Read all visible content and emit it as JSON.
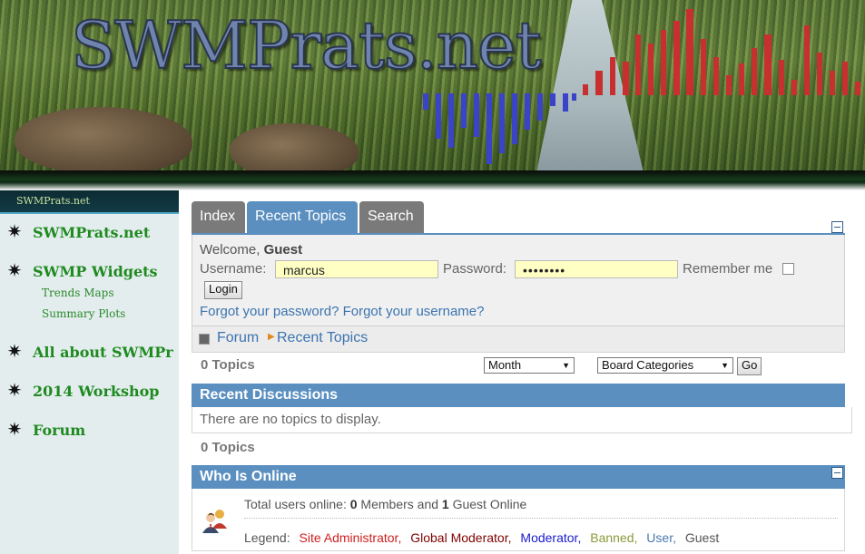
{
  "banner": {
    "site_title": "SWMPrats.net"
  },
  "sidebar": {
    "header_title": "SWMPrats.net",
    "items": [
      {
        "label": "SWMPrats.net",
        "icon": "star-burst-icon"
      },
      {
        "label": "SWMP Widgets",
        "icon": "star-burst-icon",
        "sub": [
          "Trends Maps",
          "Summary Plots"
        ]
      },
      {
        "label": "All about SWMPr",
        "icon": "star-burst-icon"
      },
      {
        "label": "2014 Workshop",
        "icon": "star-burst-icon"
      },
      {
        "label": "Forum",
        "icon": "star-burst-icon"
      }
    ]
  },
  "tabs": [
    {
      "label": "Index",
      "active": false
    },
    {
      "label": "Recent Topics",
      "active": true
    },
    {
      "label": "Search",
      "active": false
    }
  ],
  "login": {
    "welcome_prefix": "Welcome,",
    "welcome_user": "Guest",
    "username_label": "Username:",
    "username_value": "marcus",
    "password_label": "Password:",
    "password_value": "••••••••",
    "remember_label": "Remember me",
    "login_button": "Login",
    "forgot_password": "Forgot your password?",
    "forgot_username": "Forgot your username?"
  },
  "breadcrumb": {
    "items": [
      "Forum",
      "Recent Topics"
    ]
  },
  "filters": {
    "topic_count_top": "0 Topics",
    "period_select": "Month",
    "board_select": "Board Categories",
    "go_button": "Go"
  },
  "recent": {
    "heading": "Recent Discussions",
    "empty_message": "There are no topics to display.",
    "topic_count_bottom": "0 Topics"
  },
  "online": {
    "heading": "Who Is Online",
    "total_prefix": "Total users online:",
    "members_count": "0",
    "members_label": "Members and",
    "guest_count": "1",
    "guest_label": "Guest Online",
    "legend_label": "Legend:",
    "legend": [
      {
        "label": "Site Administrator,",
        "color": "#d02020"
      },
      {
        "label": "Global Moderator,",
        "color": "#800000"
      },
      {
        "label": "Moderator,",
        "color": "#1a1ad0"
      },
      {
        "label": "Banned,",
        "color": "#8a9a3a"
      },
      {
        "label": "User,",
        "color": "#4a7ab0"
      },
      {
        "label": "Guest",
        "color": "#555555"
      }
    ]
  },
  "colors": {
    "accent_blue": "#5a8fc0",
    "sidebar_green": "#1f8a1f",
    "input_yellow": "#ffffc4"
  }
}
